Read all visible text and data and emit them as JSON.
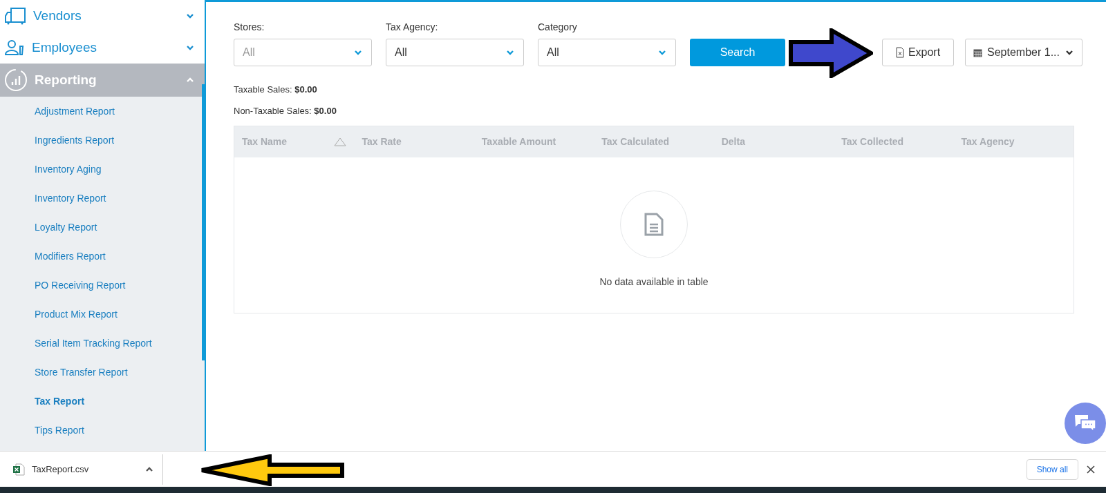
{
  "sidebar": {
    "groups": [
      {
        "label": "Vendors",
        "expanded": false,
        "selected": false
      },
      {
        "label": "Employees",
        "expanded": false,
        "selected": false
      },
      {
        "label": "Reporting",
        "expanded": true,
        "selected": true,
        "items": [
          {
            "label": "Adjustment Report",
            "selected": false
          },
          {
            "label": "Ingredients Report",
            "selected": false
          },
          {
            "label": "Inventory Aging",
            "selected": false
          },
          {
            "label": "Inventory Report",
            "selected": false
          },
          {
            "label": "Loyalty Report",
            "selected": false
          },
          {
            "label": "Modifiers Report",
            "selected": false
          },
          {
            "label": "PO Receiving Report",
            "selected": false
          },
          {
            "label": "Product Mix Report",
            "selected": false
          },
          {
            "label": "Serial Item Tracking Report",
            "selected": false
          },
          {
            "label": "Store Transfer Report",
            "selected": false
          },
          {
            "label": "Tax Report",
            "selected": true
          },
          {
            "label": "Tips Report",
            "selected": false
          }
        ]
      }
    ]
  },
  "filters": [
    {
      "label": "Stores:",
      "value": "All",
      "disabled": true
    },
    {
      "label": "Tax Agency:",
      "value": "All",
      "disabled": false
    },
    {
      "label": "Category",
      "value": "All",
      "disabled": false
    }
  ],
  "search_button": "Search",
  "export_button": "Export",
  "date_range": "September 1...",
  "summary": [
    {
      "label": "Taxable Sales:",
      "value": "$0.00"
    },
    {
      "label": "Non-Taxable Sales:",
      "value": "$0.00"
    }
  ],
  "table": {
    "columns": [
      "Tax Name",
      "Tax Rate",
      "Taxable Amount",
      "Tax Calculated",
      "Delta",
      "Tax Collected",
      "Tax Agency"
    ],
    "empty_message": "No data available in table"
  },
  "download_bar": {
    "file": "TaxReport.csv",
    "show_all": "Show all"
  }
}
